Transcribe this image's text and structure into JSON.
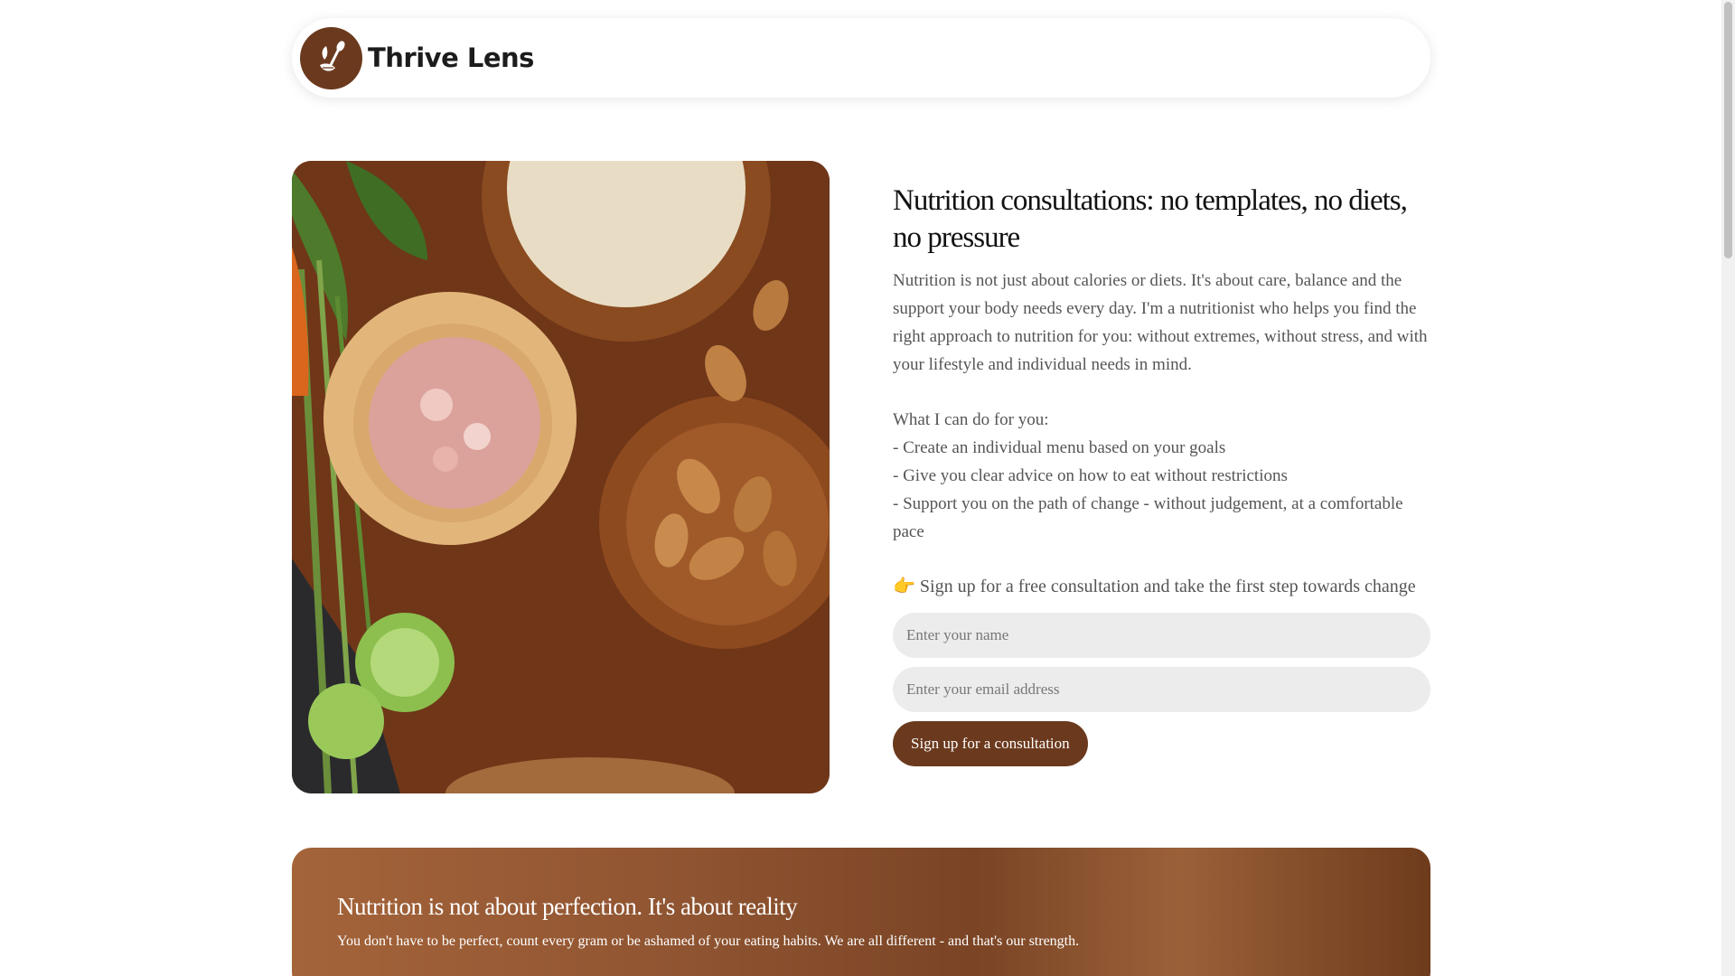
{
  "brand": {
    "name": "Thrive Lens",
    "accent_color": "#6b3a1e"
  },
  "hero": {
    "image_icon": "food-photo-icon",
    "title": "Nutrition consultations: no templates, no diets, no pressure",
    "intro": "Nutrition is not just about calories or diets. It's about care, balance and the support your body needs every day. I'm a nutritionist who helps you find the right approach to nutrition for you: without extremes, without stress, and with your lifestyle and individual needs in mind.",
    "offer_heading": "What I can do for you:",
    "offer_items": [
      "- Create an individual menu based on your goals",
      "- Give you clear advice on how to eat without restrictions",
      "- Support you on the path of change - without judgement, at a comfortable pace"
    ],
    "cta_icon": "👉",
    "cta_text": "Sign up for a free consultation and take the first step towards change"
  },
  "form": {
    "name_placeholder": "Enter your name",
    "email_placeholder": "Enter your email address",
    "submit_label": "Sign up for a consultation"
  },
  "banner": {
    "title": "Nutrition is not about perfection. It's about reality",
    "text": "You don't have to be perfect, count every gram or be ashamed of your eating habits. We are all different - and that's our strength."
  }
}
